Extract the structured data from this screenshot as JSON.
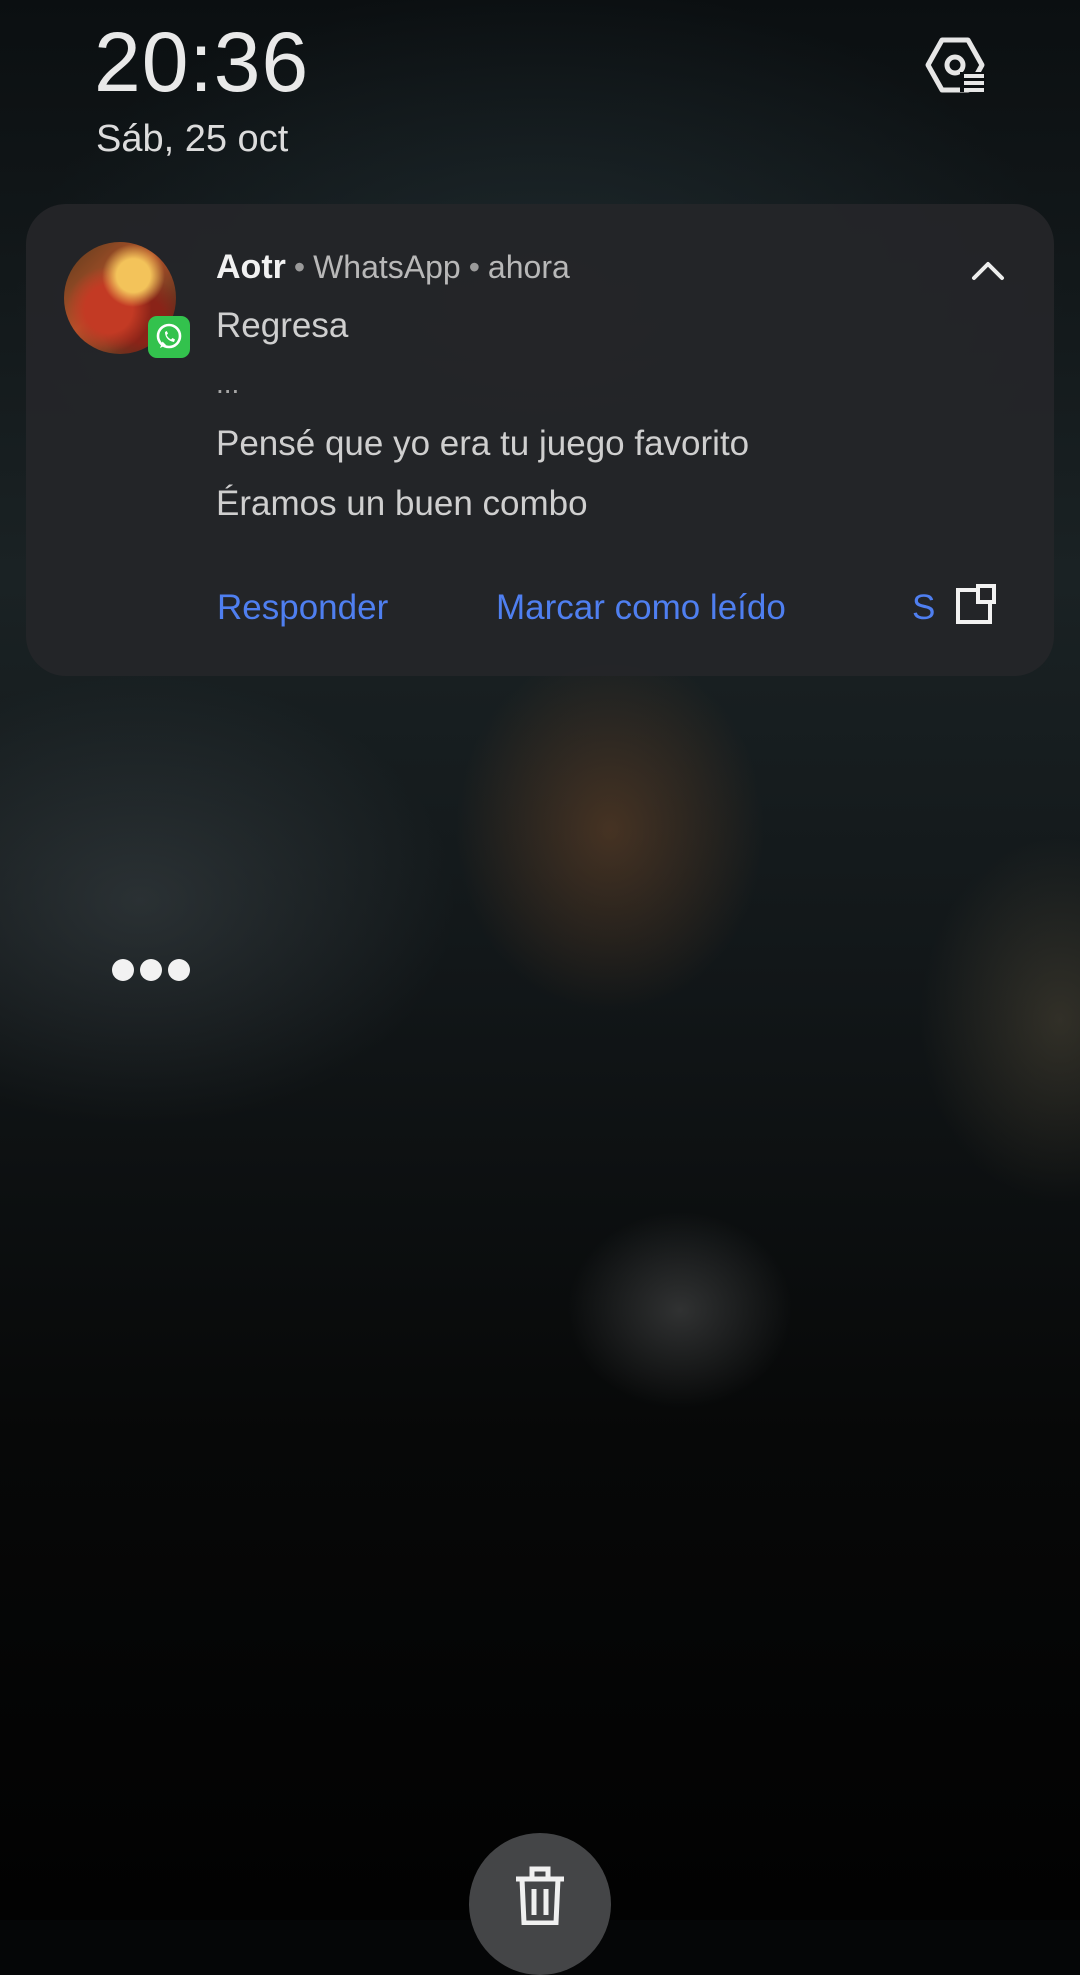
{
  "lockscreen": {
    "time": "20:36",
    "date": "Sáb, 25 oct"
  },
  "notification": {
    "sender": "Aotr",
    "app": "WhatsApp",
    "time": "ahora",
    "messages": [
      "Regresa",
      "...",
      "Pensé que yo era tu juego favorito",
      "Éramos un buen combo"
    ],
    "actions": {
      "reply": "Responder",
      "mark_read": "Marcar como leído",
      "third": "S"
    }
  },
  "icons": {
    "settings": "gear-icon",
    "collapse": "chevron-up-icon",
    "expand": "open-in-new-icon",
    "more": "more-dots-icon",
    "trash": "trash-icon",
    "app_badge": "whatsapp-icon"
  },
  "colors": {
    "accent": "#4f7ff0",
    "whatsapp": "#33c24d",
    "card": "#242528"
  }
}
